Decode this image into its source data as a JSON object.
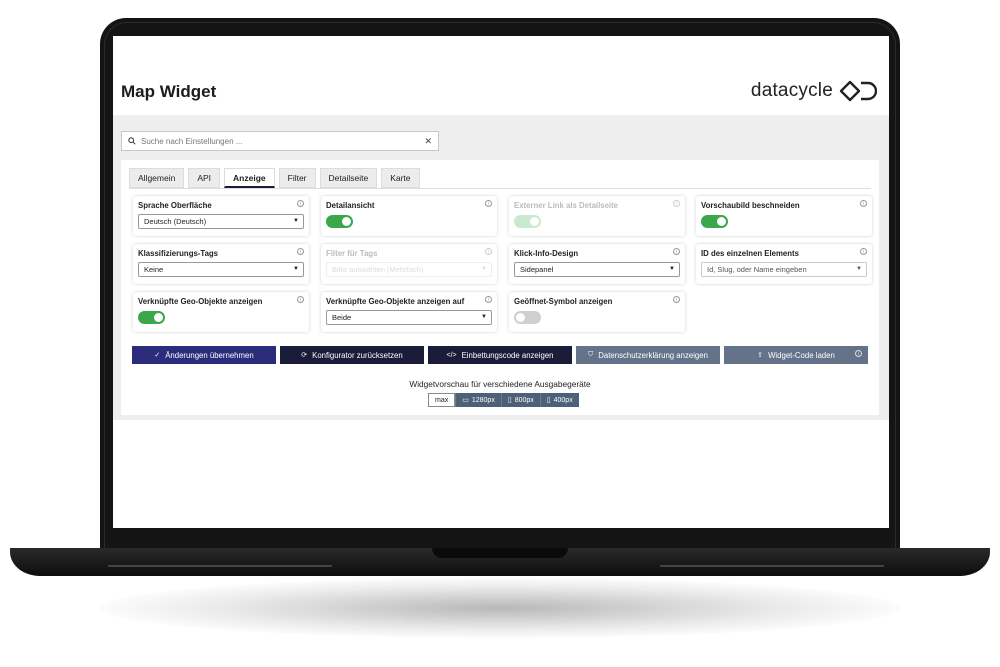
{
  "page_title": "Map Widget",
  "brand": {
    "name": "datacycle"
  },
  "search": {
    "placeholder": "Suche nach Einstellungen ..."
  },
  "tabs": [
    {
      "label": "Allgemein",
      "active": false
    },
    {
      "label": "API",
      "active": false
    },
    {
      "label": "Anzeige",
      "active": true
    },
    {
      "label": "Filter",
      "active": false
    },
    {
      "label": "Detailseite",
      "active": false
    },
    {
      "label": "Karte",
      "active": false
    }
  ],
  "settings": {
    "sprache": {
      "label": "Sprache Oberfläche",
      "value": "Deutsch (Deutsch)"
    },
    "detailansicht": {
      "label": "Detailansicht",
      "enabled": true
    },
    "externer_link": {
      "label": "Externer Link als Detailseite",
      "enabled": true,
      "disabled": true
    },
    "vorschaubild": {
      "label": "Vorschaubild beschneiden",
      "enabled": true
    },
    "klassifizierung": {
      "label": "Klassifizierungs-Tags",
      "value": "Keine"
    },
    "filter_tags": {
      "label": "Filter für Tags",
      "value": "Bitte auswählen (Mehrfach)",
      "disabled": true
    },
    "klick_info": {
      "label": "Klick-Info-Design",
      "value": "Sidepanel"
    },
    "element_id": {
      "label": "ID des einzelnen Elements",
      "placeholder": "Id, Slug, oder Name eingeben"
    },
    "geo_objekte": {
      "label": "Verknüpfte Geo-Objekte anzeigen",
      "enabled": true
    },
    "geo_objekte_auf": {
      "label": "Verknüpfte Geo-Objekte anzeigen auf",
      "value": "Beide"
    },
    "geoeffnet_symbol": {
      "label": "Geöffnet-Symbol anzeigen",
      "enabled": false
    }
  },
  "actions": {
    "apply": "Änderungen übernehmen",
    "reset": "Konfigurator zurücksetzen",
    "embed": "Einbettungscode anzeigen",
    "privacy": "Datenschutzerklärung anzeigen",
    "load": "Widget-Code laden"
  },
  "preview": {
    "caption": "Widgetvorschau für verschiedene Ausgabegeräte",
    "devices": [
      "max",
      "1280px",
      "800px",
      "400px"
    ],
    "active_device": "max"
  },
  "colors": {
    "primary": "#2b2d7c",
    "dark": "#1b1b3a",
    "muted": "#64738a",
    "toggle_on": "#3aa84a",
    "toggle_off": "#cfcfcf"
  }
}
